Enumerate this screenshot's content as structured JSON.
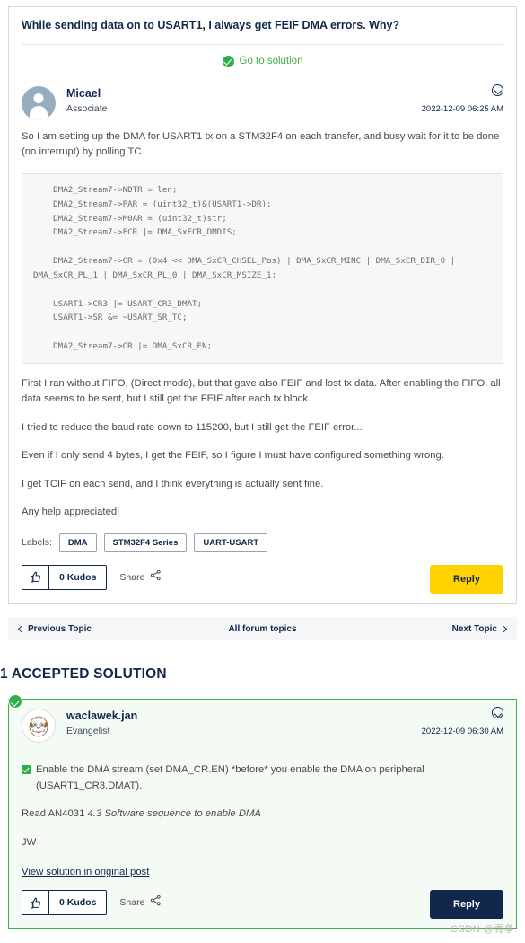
{
  "topic": {
    "title": "While sending data on to USART1, I always get FEIF DMA errors. Why?",
    "go_to_solution": "Go to solution",
    "solution_check_icon": "check-circle-icon"
  },
  "original_post": {
    "author": "Micael",
    "rank": "Associate",
    "date": "2022-12-09 06:25 AM",
    "avatar_icon": "user-silhouette-avatar",
    "options_icon": "chevron-down-circle-icon",
    "intro": "So I am setting up the DMA for USART1 tx on a STM32F4 on each transfer, and busy wait for it to be done (no interrupt) by polling TC.",
    "code": "    DMA2_Stream7->NDTR = len;\n    DMA2_Stream7->PAR = (uint32_t)&(USART1->DR);\n    DMA2_Stream7->M0AR = (uint32_t)str;\n    DMA2_Stream7->FCR |= DMA_SxFCR_DMDIS;\n\n    DMA2_Stream7->CR = (0x4 << DMA_SxCR_CHSEL_Pos) | DMA_SxCR_MINC | DMA_SxCR_DIR_0 | DMA_SxCR_PL_1 | DMA_SxCR_PL_0 | DMA_SxCR_MSIZE_1;\n\n    USART1->CR3 |= USART_CR3_DMAT;\n    USART1->SR &= ~USART_SR_TC;\n\n    DMA2_Stream7->CR |= DMA_SxCR_EN;",
    "paragraphs": [
      "First I ran without FIFO, (Direct mode), but that gave also FEIF and lost tx data. After enabling the FIFO, all data seems to be sent, but I still get the FEIF after each tx block.",
      "I tried to reduce the baud rate down to 115200, but I still get the FEIF error...",
      "Even if I only send 4 bytes, I get the FEIF, so I figure I must have configured something wrong.",
      "I get TCIF on each send, and I think everything is actually sent fine.",
      "Any help appreciated!"
    ],
    "labels_caption": "Labels:",
    "labels": [
      "DMA",
      "STM32F4 Series",
      "UART-USART"
    ],
    "kudos_label": "0 Kudos",
    "kudos_icon": "thumbs-up-icon",
    "share_label": "Share",
    "share_icon": "share-nodes-icon",
    "reply_label": "Reply"
  },
  "topic_nav": {
    "previous": "Previous Topic",
    "all": "All forum topics",
    "next": "Next Topic",
    "prev_icon": "chevron-left-icon",
    "next_icon": "chevron-right-icon"
  },
  "accepted": {
    "heading": "1 ACCEPTED SOLUTION",
    "badge_icon": "accepted-solution-check-icon",
    "author": "waclawek.jan",
    "rank": "Evangelist",
    "date": "2022-12-09 06:30 AM",
    "avatar_icon": "cartoon-face-avatar",
    "options_icon": "chevron-down-circle-icon",
    "line1": "Enable the DMA stream (set DMA_CR.EN) *before* you enable the DMA on peripheral (USART1_CR3.DMAT).",
    "line1_icon": "green-check-box-icon",
    "line2_prefix": "Read AN4031 ",
    "line2_italic": "4.3 Software sequence to enable DMA",
    "line3": "JW",
    "view_solution_link": "View solution in original post",
    "kudos_label": "0 Kudos",
    "kudos_icon": "thumbs-up-icon",
    "share_label": "Share",
    "share_icon": "share-nodes-icon",
    "reply_label": "Reply"
  },
  "watermark": "CSDN @青争.",
  "colors": {
    "navy": "#10284b",
    "green": "#2fae4a",
    "yellow": "#ffd200",
    "code_bg": "#f7f7f7",
    "solution_bg": "#f4fbf5"
  }
}
